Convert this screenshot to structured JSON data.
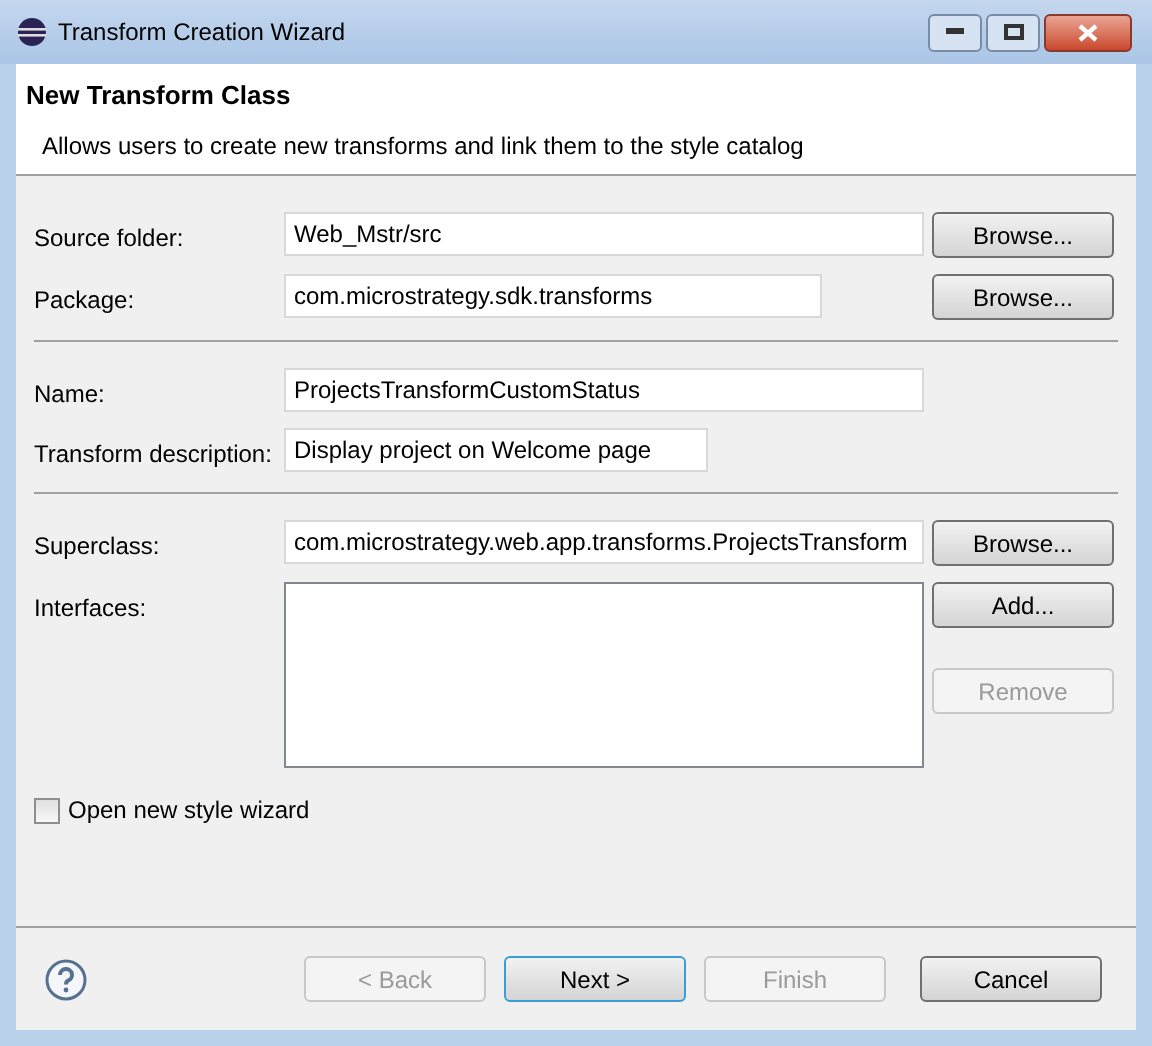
{
  "window": {
    "title": "Transform Creation Wizard"
  },
  "header": {
    "title": "New Transform Class",
    "description": "Allows users to create new transforms and link them to the style catalog"
  },
  "sections": [
    {
      "rows": [
        {
          "kind": "text",
          "label": "Source folder:",
          "value": "Web_Mstr/src",
          "buttons": [
            {
              "label": "Browse...",
              "disabled": false
            }
          ]
        },
        {
          "kind": "text",
          "label": "Package:",
          "value": "com.microstrategy.sdk.transforms",
          "buttons": [
            {
              "label": "Browse...",
              "disabled": false
            }
          ]
        }
      ]
    },
    {
      "rows": [
        {
          "kind": "text",
          "label": "Name:",
          "value": "ProjectsTransformCustomStatus"
        },
        {
          "kind": "text",
          "label": "Transform description:",
          "value": "Display project on Welcome page"
        }
      ]
    },
    {
      "rows": [
        {
          "kind": "text",
          "label": "Superclass:",
          "value": "com.microstrategy.web.app.transforms.ProjectsTransform",
          "buttons": [
            {
              "label": "Browse...",
              "disabled": false
            }
          ]
        },
        {
          "kind": "list",
          "label": "Interfaces:",
          "buttons": [
            {
              "label": "Add...",
              "disabled": false
            },
            {
              "label": "Remove",
              "disabled": true
            }
          ]
        }
      ]
    }
  ],
  "checkbox": {
    "label": "Open new style wizard",
    "checked": false
  },
  "footer": {
    "buttons": [
      {
        "label": "< Back",
        "disabled": true,
        "default": false
      },
      {
        "label": "Next >",
        "disabled": false,
        "default": true
      },
      {
        "label": "Finish",
        "disabled": true,
        "default": false
      },
      {
        "label": "Cancel",
        "disabled": false,
        "default": false
      }
    ]
  }
}
